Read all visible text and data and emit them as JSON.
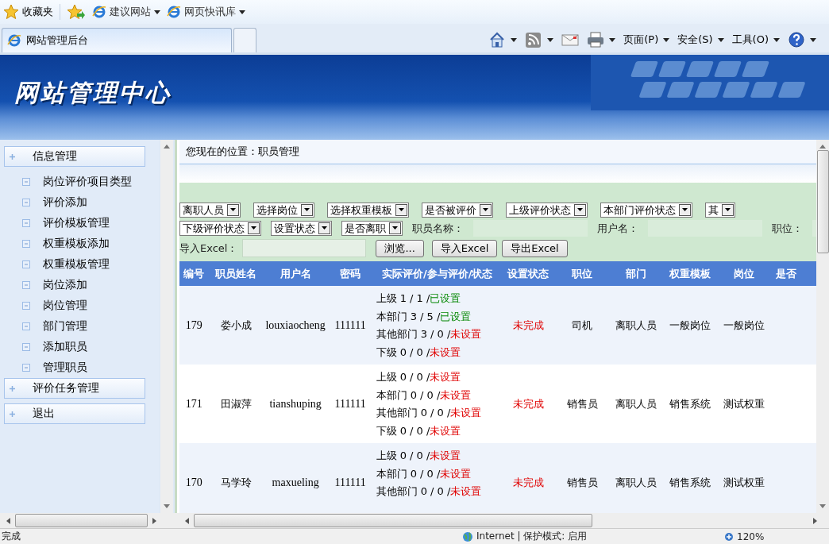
{
  "favorites_bar": {
    "favorites": "收藏夹",
    "links": [
      "建议网站",
      "网页快讯库"
    ]
  },
  "tabs": [
    {
      "label": "网站管理后台",
      "selected": true
    }
  ],
  "command_bar": {
    "menus": [
      "页面(P)",
      "安全(S)",
      "工具(O)"
    ]
  },
  "banner": {
    "title": "网站管理中心"
  },
  "sidebar": {
    "groups": [
      {
        "label": "信息管理",
        "children": [
          {
            "label": "岗位评价项目类型"
          },
          {
            "label": "评价添加"
          },
          {
            "label": "评价模板管理"
          },
          {
            "label": "权重模板添加"
          },
          {
            "label": "权重模板管理"
          },
          {
            "label": "岗位添加"
          },
          {
            "label": "岗位管理"
          },
          {
            "label": "部门管理"
          },
          {
            "label": "添加职员"
          },
          {
            "label": "管理职员"
          }
        ]
      },
      {
        "label": "评价任务管理"
      },
      {
        "label": "退出"
      }
    ]
  },
  "breadcrumb": "您现在的位置：职员管理",
  "filters": {
    "row1": [
      "离职人员",
      "选择岗位",
      "选择权重模板",
      "是否被评价",
      "上级评价状态",
      "本部门评价状态",
      "其"
    ],
    "row2": [
      "下级评价状态",
      "设置状态",
      "是否离职"
    ],
    "fields": [
      {
        "label": "职员名称："
      },
      {
        "label": "用户名："
      },
      {
        "label": "职位："
      }
    ],
    "import_label": "导入Excel：",
    "buttons": [
      "浏览...",
      "导入Excel",
      "导出Excel"
    ]
  },
  "table": {
    "columns": [
      "编号",
      "职员姓名",
      "用户名",
      "密码",
      "实际评价/参与评价/状态",
      "设置状态",
      "职位",
      "部门",
      "权重模板",
      "岗位",
      "是否"
    ],
    "rows": [
      {
        "id": "179",
        "name": "娄小成",
        "username": "louxiaocheng",
        "password": "111111",
        "evaluations": [
          {
            "text": "上级 1 / 1 /",
            "status": "已设置",
            "set": true
          },
          {
            "text": "本部门 3 / 5 /",
            "status": "已设置",
            "set": true
          },
          {
            "text": "其他部门 3 / 0 /",
            "status": "未设置",
            "set": false
          },
          {
            "text": "下级 0 / 0 /",
            "status": "未设置",
            "set": false
          }
        ],
        "setting": "未完成",
        "complete": false,
        "position": "司机",
        "department": "离职人员",
        "weight_template": "一般岗位",
        "post": "一般岗位"
      },
      {
        "id": "171",
        "name": "田淑萍",
        "username": "tianshuping",
        "password": "111111",
        "evaluations": [
          {
            "text": "上级 0 / 0 /",
            "status": "未设置",
            "set": false
          },
          {
            "text": "本部门 0 / 0 /",
            "status": "未设置",
            "set": false
          },
          {
            "text": "其他部门 0 / 0 /",
            "status": "未设置",
            "set": false
          },
          {
            "text": "下级 0 / 0 /",
            "status": "未设置",
            "set": false
          }
        ],
        "setting": "未完成",
        "complete": false,
        "position": "销售员",
        "department": "离职人员",
        "weight_template": "销售系统",
        "post": "测试权重"
      },
      {
        "id": "170",
        "name": "马学玲",
        "username": "maxueling",
        "password": "111111",
        "evaluations": [
          {
            "text": "上级 0 / 0 /",
            "status": "未设置",
            "set": false
          },
          {
            "text": "本部门 0 / 0 /",
            "status": "未设置",
            "set": false
          },
          {
            "text": "其他部门 0 / 0 /",
            "status": "未设置",
            "set": false
          }
        ],
        "setting": "未完成",
        "complete": false,
        "position": "销售员",
        "department": "离职人员",
        "weight_template": "销售系统",
        "post": "测试权重"
      }
    ]
  },
  "status_bar": {
    "text": "完成",
    "zone": "Internet | 保护模式: 启用",
    "zoom": "120%"
  }
}
